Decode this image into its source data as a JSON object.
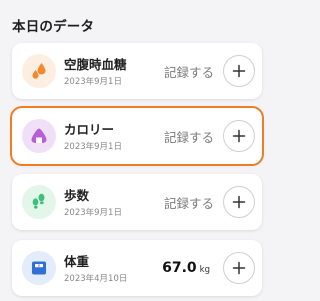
{
  "section": {
    "title": "本日のデータ"
  },
  "cards": [
    {
      "name": "空腹時血糖",
      "date": "2023年9月1日",
      "action": "記録する",
      "icon": "blood-drops-icon",
      "icon_bg": "#fdeee2",
      "icon_color": "#f08a2c"
    },
    {
      "name": "カロリー",
      "date": "2023年9月1日",
      "action": "記録する",
      "icon": "rice-ball-icon",
      "icon_bg": "#efe0f7",
      "icon_color": "#b65fd6",
      "selected": true
    },
    {
      "name": "歩数",
      "date": "2023年9月1日",
      "action": "記録する",
      "icon": "footprints-icon",
      "icon_bg": "#e2f6ea",
      "icon_color": "#3cc07a"
    },
    {
      "name": "体重",
      "date": "2023年4月10日",
      "value": "67.0",
      "unit": "kg",
      "icon": "scale-icon",
      "icon_bg": "#e2ecfa",
      "icon_color": "#2f6fd6"
    }
  ],
  "add_button": {
    "symbol": "+"
  },
  "colors": {
    "highlight": "#f07d24"
  }
}
